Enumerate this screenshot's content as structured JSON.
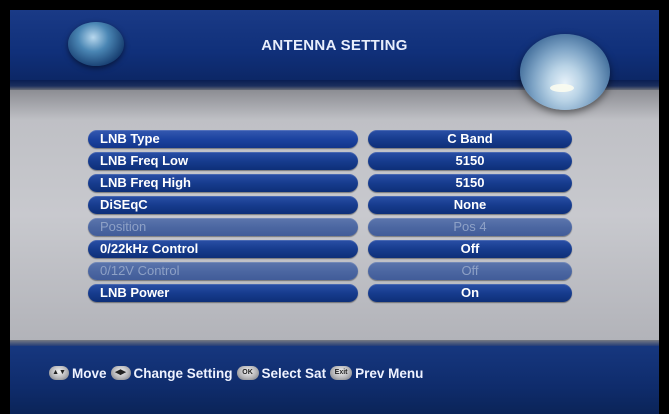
{
  "header": {
    "title": "ANTENNA SETTING"
  },
  "settings": [
    {
      "label": "LNB Type",
      "value": "C Band",
      "enabled": true
    },
    {
      "label": "LNB Freq Low",
      "value": "5150",
      "enabled": true
    },
    {
      "label": "LNB Freq High",
      "value": "5150",
      "enabled": true
    },
    {
      "label": "DiSEqC",
      "value": "None",
      "enabled": true
    },
    {
      "label": "Position",
      "value": "Pos 4",
      "enabled": false
    },
    {
      "label": "0/22kHz Control",
      "value": "Off",
      "enabled": true
    },
    {
      "label": "0/12V Control",
      "value": "Off",
      "enabled": false
    },
    {
      "label": "LNB Power",
      "value": "On",
      "enabled": true
    }
  ],
  "footer": {
    "move_label": "Move",
    "change_label": "Change Setting",
    "select_label": "Select Sat",
    "prev_label": "Prev Menu",
    "ok_key": "OK",
    "exit_key": "Exit"
  },
  "colors": {
    "header_bg": "#12317a",
    "pill_bg": "#173c8e",
    "panel_bg": "#c3c4c9",
    "disabled_text": "#8ea1c6"
  }
}
